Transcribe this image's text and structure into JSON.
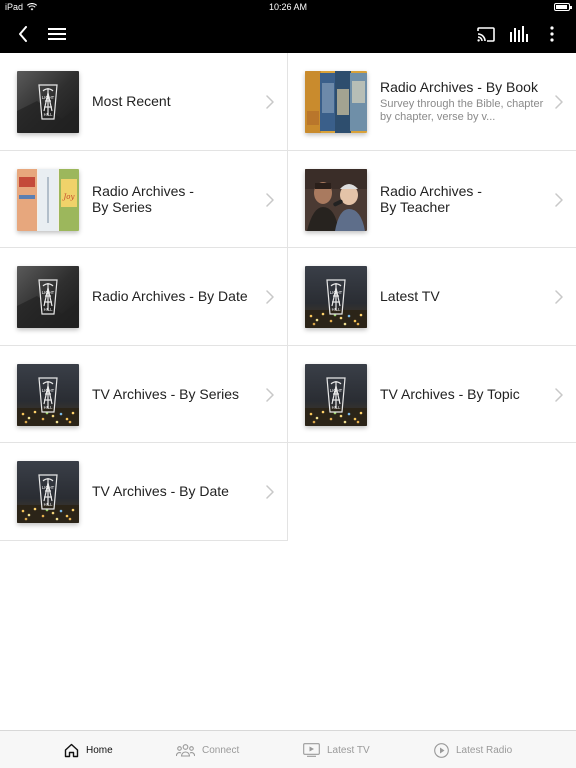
{
  "status": {
    "carrier": "iPad",
    "time": "10:26 AM",
    "battery_level": 0.9
  },
  "navbar": {
    "back_icon": "chevron-left-icon",
    "menu_icon": "hamburger-menu-icon",
    "cast_icon": "cast-icon",
    "equalizer_icon": "equalizer-icon",
    "more_icon": "more-vertical-icon"
  },
  "items": [
    {
      "title": "Most Recent",
      "subtitle": "",
      "art": "light-hill-bw"
    },
    {
      "title": "Radio Archives - By Book",
      "subtitle": "Survey through the Bible, chapter by chapter, verse by v...",
      "art": "book-collage"
    },
    {
      "title": "Radio Archives -\nBy Series",
      "subtitle": "",
      "art": "series-covers"
    },
    {
      "title": "Radio Archives -\nBy Teacher",
      "subtitle": "",
      "art": "teachers-photo"
    },
    {
      "title": "Radio Archives - By Date",
      "subtitle": "",
      "art": "light-hill-bw"
    },
    {
      "title": "Latest TV",
      "subtitle": "",
      "art": "light-hill-city"
    },
    {
      "title": "TV Archives - By Series",
      "subtitle": "",
      "art": "light-hill-city"
    },
    {
      "title": "TV Archives - By Topic",
      "subtitle": "",
      "art": "light-hill-city"
    },
    {
      "title": "TV Archives - By Date",
      "subtitle": "",
      "art": "light-hill-city"
    }
  ],
  "tabs": [
    {
      "label": "Home",
      "icon": "home-icon",
      "active": true
    },
    {
      "label": "Connect",
      "icon": "people-icon",
      "active": false
    },
    {
      "label": "Latest TV",
      "icon": "tv-play-icon",
      "active": false
    },
    {
      "label": "Latest Radio",
      "icon": "play-circle-icon",
      "active": false
    }
  ],
  "colors": {
    "bar": "#000000",
    "divider": "#e3e3e3",
    "tab_active": "#111111",
    "tab_inactive": "#9a9a9a"
  }
}
